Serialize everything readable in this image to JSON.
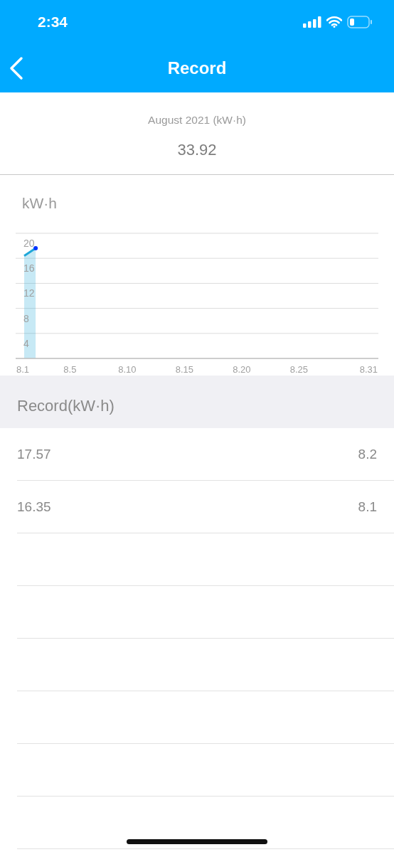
{
  "status_bar": {
    "time": "2:34"
  },
  "nav": {
    "title": "Record"
  },
  "summary": {
    "period": "August 2021 (kW·h)",
    "total": "33.92"
  },
  "chart": {
    "unit": "kW·h",
    "chart_data": {
      "type": "area",
      "categories": [
        "8.1",
        null,
        null,
        null,
        "8.5",
        null,
        null,
        null,
        null,
        "8.10",
        null,
        null,
        null,
        null,
        "8.15",
        null,
        null,
        null,
        null,
        "8.20",
        null,
        null,
        null,
        null,
        "8.25",
        null,
        null,
        null,
        null,
        null,
        "8.31"
      ],
      "series": [
        {
          "color": "#1ea7d8",
          "values": [
            16.4,
            17.6,
            null,
            null,
            null,
            null,
            null,
            null,
            null,
            null,
            null,
            null,
            null,
            null,
            null,
            null,
            null,
            null,
            null,
            null,
            null,
            null,
            null,
            null,
            null,
            null,
            null,
            null,
            null,
            null,
            null
          ]
        }
      ],
      "grid": true,
      "ylim": [
        0,
        20
      ],
      "yticks": [
        4,
        8,
        12,
        16,
        20
      ]
    }
  },
  "records": {
    "title": "Record(kW·h)",
    "rows": [
      {
        "value": "17.57",
        "date": "8.2"
      },
      {
        "value": "16.35",
        "date": "8.1"
      }
    ]
  }
}
